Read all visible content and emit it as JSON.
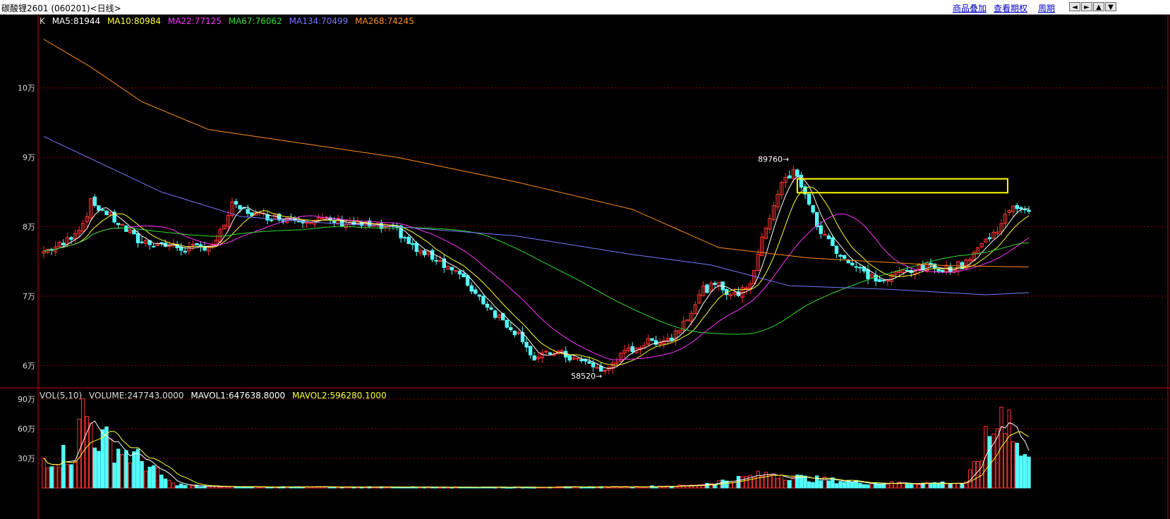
{
  "window": {
    "title": "碳酸锂2601 (060201)<日线>",
    "links": [
      "商品叠加",
      "查看期权",
      "周期"
    ],
    "nav_buttons": [
      "◄",
      "►",
      "▲",
      "▼"
    ]
  },
  "colors": {
    "background": "#000000",
    "up": "#ff3232",
    "down": "#54ffff",
    "grid": "#8b0000",
    "axis": "#c00000",
    "ma5": "#ffffff",
    "ma10": "#ffff33",
    "ma22": "#ff33ff",
    "ma67": "#33dd33",
    "ma134": "#7777ff",
    "ma268": "#ff8c1a",
    "highlight_box": "#ffff00"
  },
  "price_legend": {
    "k": "K",
    "ma5": "MA5:81944",
    "ma10": "MA10:80984",
    "ma22": "MA22:77125",
    "ma67": "MA67:76062",
    "ma134": "MA134:70499",
    "ma268": "MA268:74245"
  },
  "volume_legend": {
    "vol": "VOL(5,10)",
    "volume": "VOLUME:247743.0000",
    "mavol1": "MAVOL1:647638.8000",
    "mavol2": "MAVOL2:596280.1000"
  },
  "chart_data": {
    "type": "candlestick",
    "price_axis": {
      "ticks": [
        60000,
        70000,
        80000,
        90000,
        100000
      ],
      "tick_labels": [
        "6万",
        "7万",
        "8万",
        "9万",
        "10万"
      ],
      "ylim": [
        57000,
        109000
      ]
    },
    "volume_axis": {
      "ticks": [
        300000,
        600000,
        900000
      ],
      "tick_labels": [
        "30万",
        "60万",
        "90万"
      ],
      "ylim": [
        0,
        1000000
      ]
    },
    "annotations": [
      {
        "text": "89760→",
        "value": 89760
      },
      {
        "text": "58520→",
        "value": 58520
      }
    ],
    "highlight_box": {
      "from_value": 84900,
      "to_value": 86900
    },
    "keypoints": [
      [
        0,
        76500
      ],
      [
        5,
        77500
      ],
      [
        10,
        80500
      ],
      [
        12,
        83500
      ],
      [
        16,
        82000
      ],
      [
        20,
        80000
      ],
      [
        24,
        78000
      ],
      [
        30,
        77500
      ],
      [
        36,
        76800
      ],
      [
        40,
        77000
      ],
      [
        44,
        77800
      ],
      [
        48,
        83000
      ],
      [
        55,
        81600
      ],
      [
        62,
        81300
      ],
      [
        70,
        81000
      ],
      [
        77,
        80600
      ],
      [
        84,
        80000
      ],
      [
        90,
        79500
      ],
      [
        95,
        76500
      ],
      [
        100,
        75500
      ],
      [
        105,
        73500
      ],
      [
        110,
        70500
      ],
      [
        115,
        67500
      ],
      [
        119,
        65500
      ],
      [
        122,
        64000
      ],
      [
        125,
        60800
      ],
      [
        130,
        62000
      ],
      [
        135,
        61000
      ],
      [
        140,
        60000
      ],
      [
        143,
        59000
      ],
      [
        145,
        60500
      ],
      [
        150,
        62500
      ],
      [
        155,
        63500
      ],
      [
        160,
        64000
      ],
      [
        165,
        68000
      ],
      [
        168,
        71000
      ],
      [
        172,
        71500
      ],
      [
        176,
        70000
      ],
      [
        180,
        72000
      ],
      [
        184,
        80000
      ],
      [
        188,
        86500
      ],
      [
        190,
        87000
      ],
      [
        191,
        88000
      ],
      [
        194,
        85000
      ],
      [
        197,
        80000
      ],
      [
        200,
        78000
      ],
      [
        203,
        76000
      ],
      [
        206,
        74500
      ],
      [
        210,
        73000
      ],
      [
        214,
        72000
      ],
      [
        218,
        73500
      ],
      [
        222,
        74000
      ],
      [
        226,
        74200
      ],
      [
        230,
        74000
      ],
      [
        234,
        74500
      ],
      [
        238,
        77000
      ],
      [
        242,
        79000
      ],
      [
        245,
        81500
      ],
      [
        248,
        83000
      ],
      [
        251,
        82500
      ]
    ],
    "ma268_keypoints": [
      [
        0,
        107000
      ],
      [
        12,
        103000
      ],
      [
        25,
        98000
      ],
      [
        42,
        94000
      ],
      [
        60,
        92500
      ],
      [
        90,
        90000
      ],
      [
        120,
        86500
      ],
      [
        150,
        82500
      ],
      [
        172,
        77000
      ],
      [
        195,
        75500
      ],
      [
        230,
        74400
      ],
      [
        251,
        74200
      ]
    ],
    "ma134_keypoints": [
      [
        0,
        93000
      ],
      [
        15,
        89000
      ],
      [
        30,
        85000
      ],
      [
        50,
        81500
      ],
      [
        70,
        80600
      ],
      [
        90,
        80000
      ],
      [
        120,
        78700
      ],
      [
        150,
        76000
      ],
      [
        170,
        74500
      ],
      [
        190,
        71500
      ],
      [
        215,
        71000
      ],
      [
        240,
        70200
      ],
      [
        251,
        70500
      ]
    ],
    "volume_keypoints": [
      [
        0,
        300000
      ],
      [
        8,
        350000
      ],
      [
        10,
        800000
      ],
      [
        14,
        500000
      ],
      [
        20,
        380000
      ],
      [
        26,
        250000
      ],
      [
        30,
        120000
      ],
      [
        33,
        40000
      ],
      [
        40,
        15000
      ],
      [
        60,
        10000
      ],
      [
        90,
        10000
      ],
      [
        120,
        8000
      ],
      [
        150,
        12000
      ],
      [
        165,
        25000
      ],
      [
        175,
        80000
      ],
      [
        186,
        150000
      ],
      [
        193,
        100000
      ],
      [
        210,
        50000
      ],
      [
        235,
        50000
      ],
      [
        238,
        300000
      ],
      [
        242,
        600000
      ],
      [
        246,
        900000
      ],
      [
        248,
        400000
      ],
      [
        251,
        300000
      ]
    ]
  }
}
